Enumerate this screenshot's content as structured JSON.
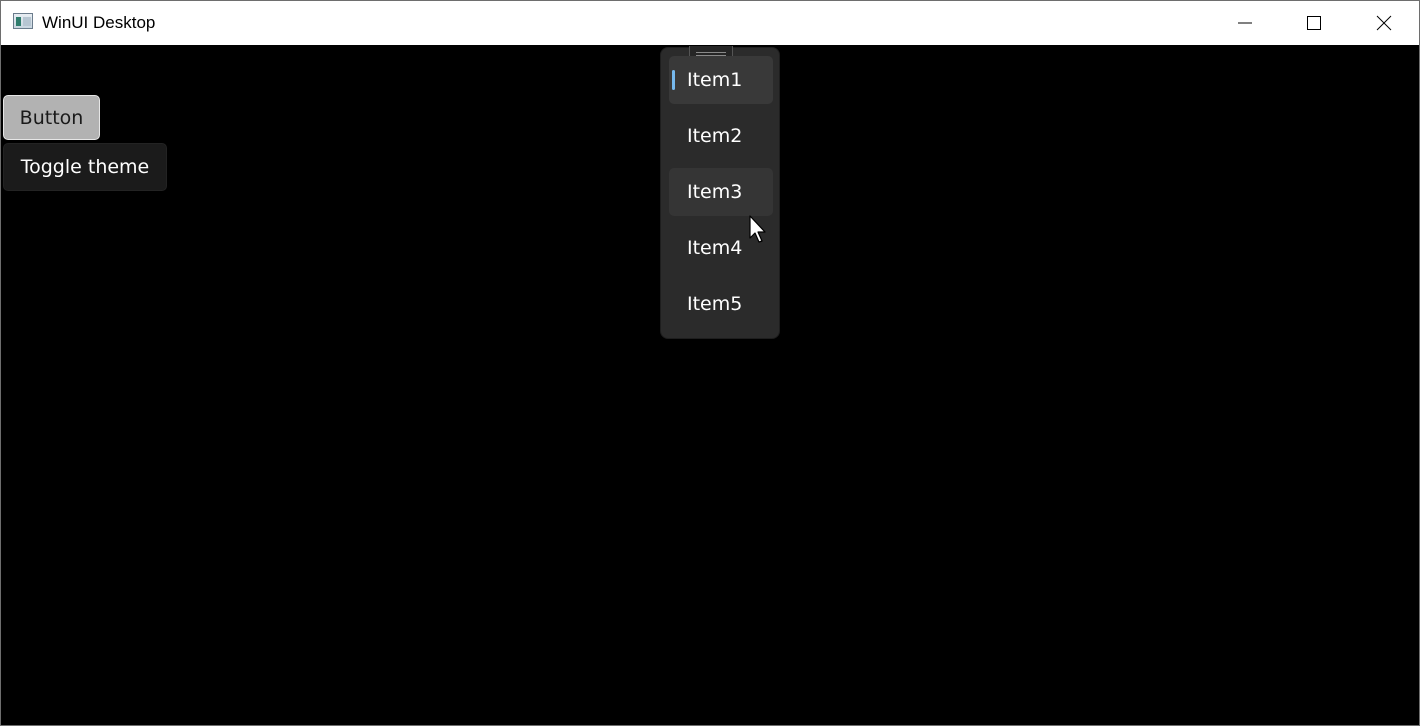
{
  "window": {
    "title": "WinUI Desktop",
    "icons": {
      "app": "app-icon",
      "minimize": "minimize-icon",
      "maximize": "maximize-icon",
      "close": "close-icon"
    }
  },
  "content": {
    "button_label": "Button",
    "toggle_theme_label": "Toggle theme"
  },
  "popup_list": {
    "items": [
      {
        "label": "Item1",
        "state": "selected"
      },
      {
        "label": "Item2",
        "state": "normal"
      },
      {
        "label": "Item3",
        "state": "hover"
      },
      {
        "label": "Item4",
        "state": "normal"
      },
      {
        "label": "Item5",
        "state": "normal"
      }
    ],
    "accent_color": "#76b9ed"
  },
  "colors": {
    "background": "#000000",
    "titlebar": "#ffffff",
    "popup_background": "#2b2b2b"
  }
}
